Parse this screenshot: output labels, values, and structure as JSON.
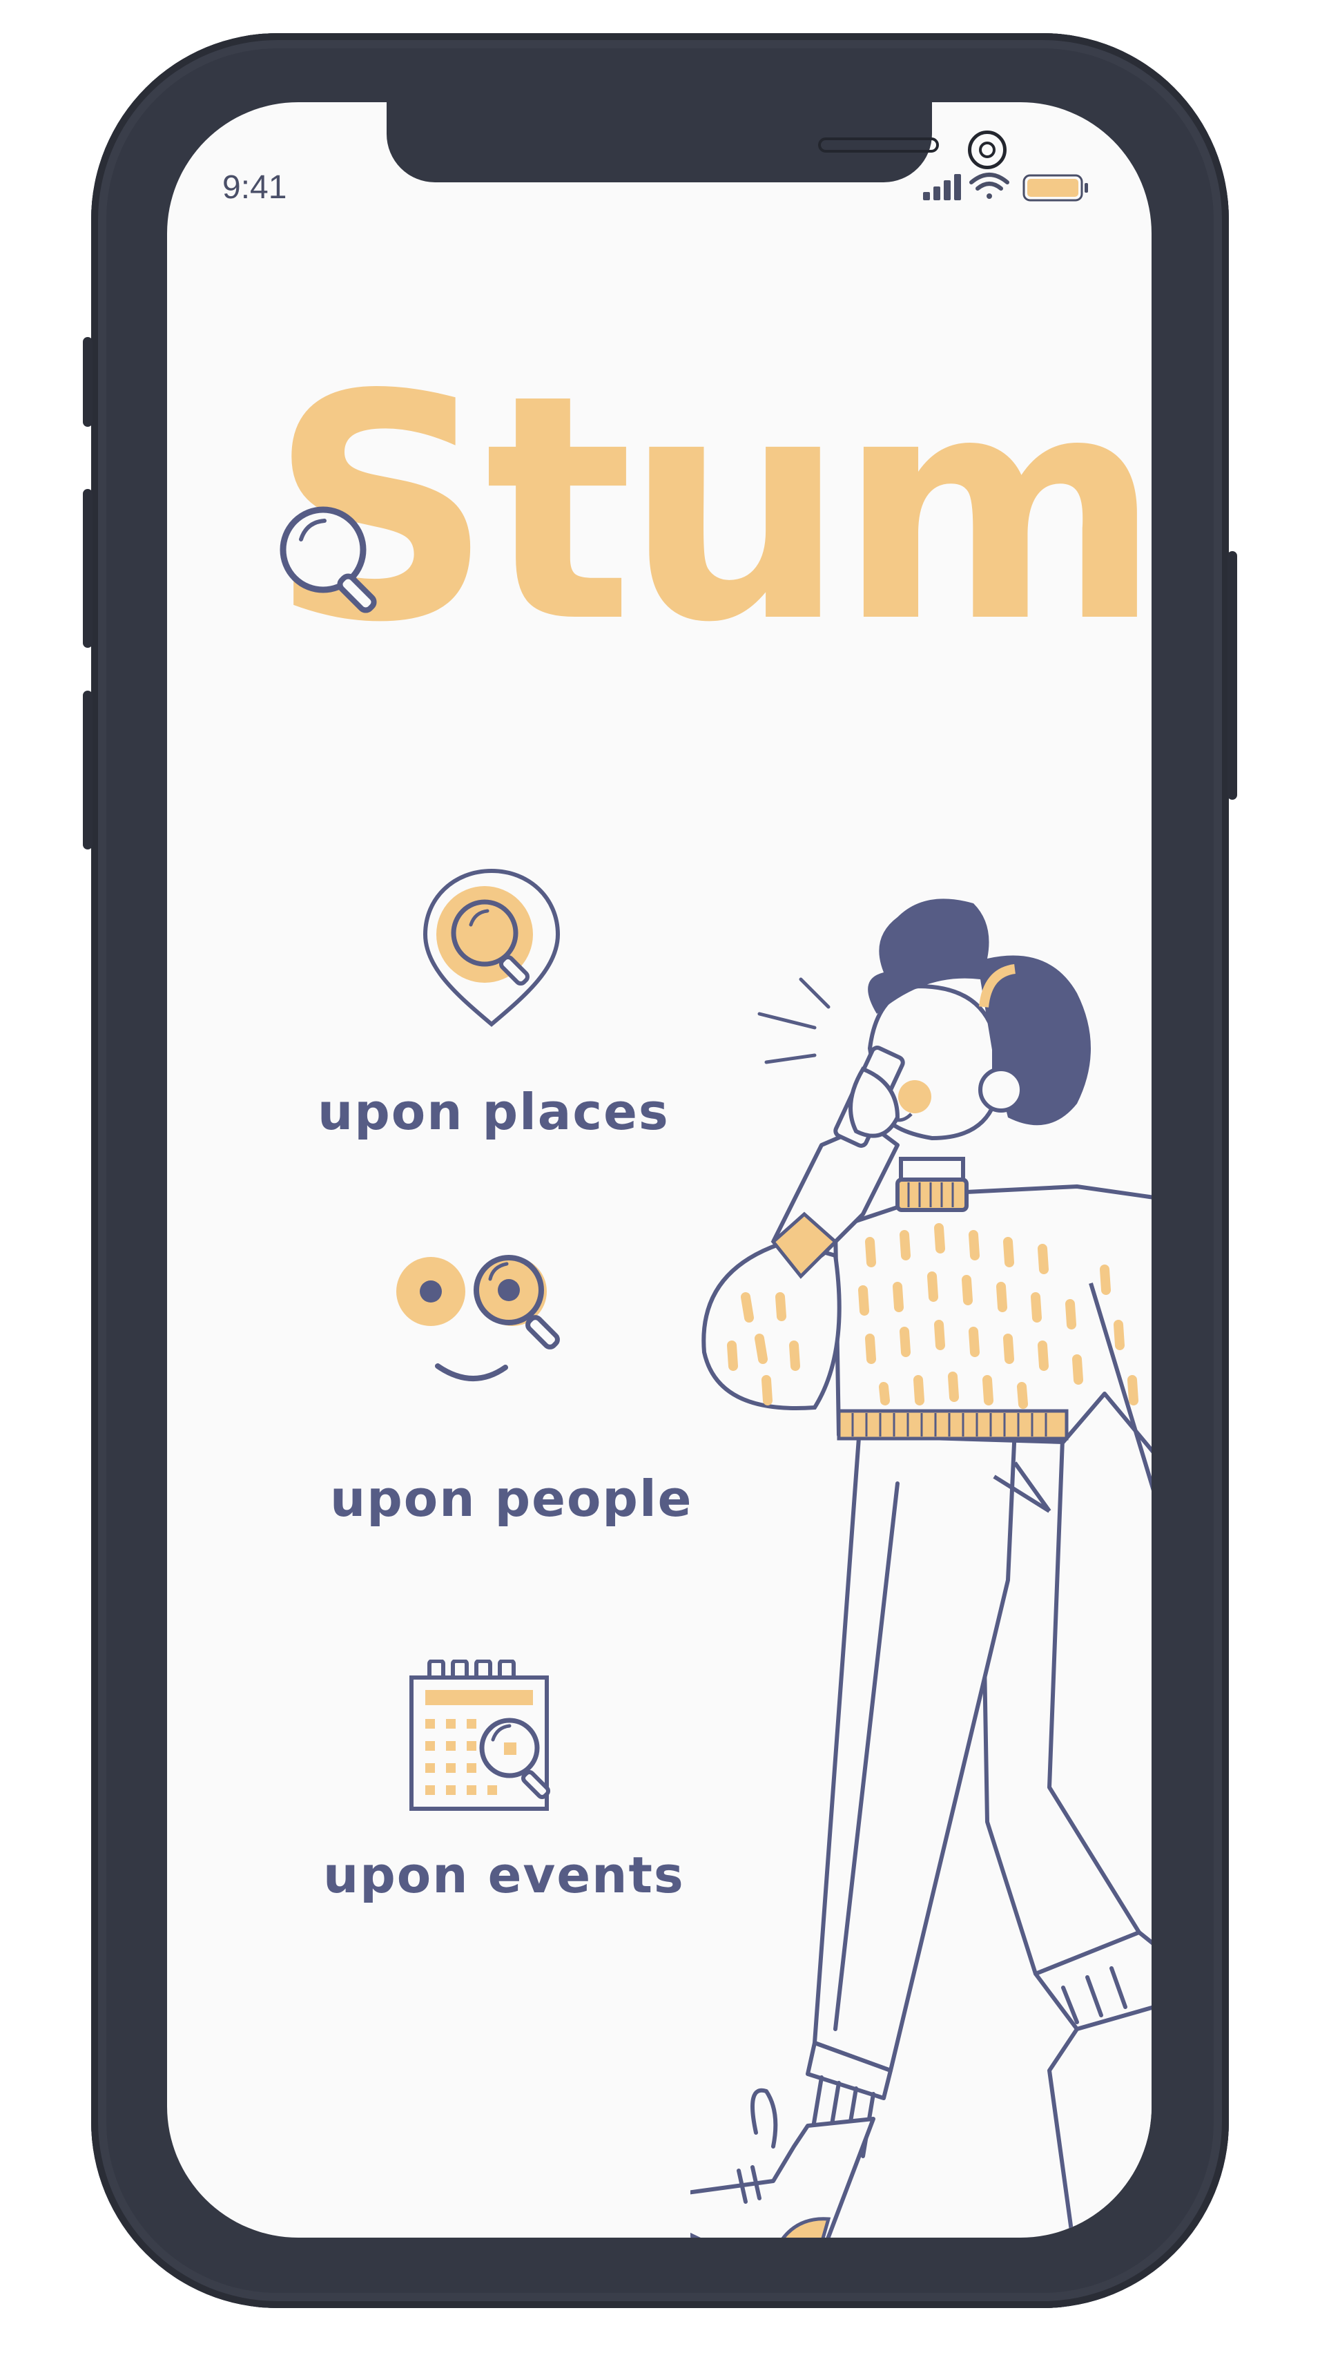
{
  "status_bar": {
    "time": "9:41"
  },
  "app": {
    "logo": "Stumbll"
  },
  "features": [
    {
      "label": "upon places",
      "icon": "map-pin-search-icon"
    },
    {
      "label": "upon people",
      "icon": "face-search-icon"
    },
    {
      "label": "upon events",
      "icon": "calendar-search-icon"
    }
  ],
  "colors": {
    "accent": "#f4c987",
    "ink": "#565c85",
    "frame": "#343844",
    "screen": "#fafafa"
  }
}
